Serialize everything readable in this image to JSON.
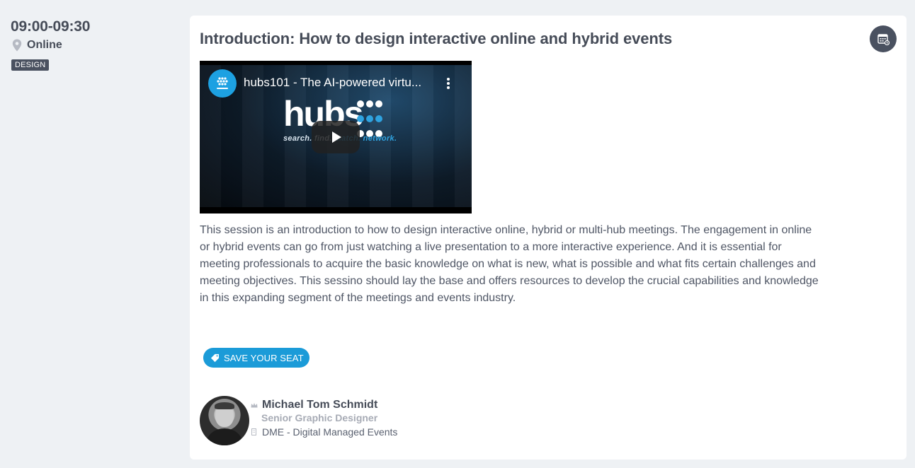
{
  "session": {
    "time": "09:00-09:30",
    "location": "Online",
    "tag": "DESIGN",
    "title": "Introduction: How to design interactive online and hybrid events",
    "description": "This session is an introduction to how to design interactive online, hybrid or multi-hub meetings. The engagement in online or hybrid events can go from just watching a live presentation to a more interactive experience. And it is essential for meeting professionals to acquire the basic knowledge on what is new, what is possible and what fits certain challenges and meeting objectives. This sessino should lay the base and offers resources to develop the crucial capabilities and knowledge in this expanding segment of the meetings and events industry.",
    "save_seat_label": "SAVE YOUR SEAT",
    "add_to_calendar_icon": "calendar-icon"
  },
  "video": {
    "title": "hubs101 - The AI-powered virtu...",
    "logo_text": "hubs",
    "tagline_a": "search. find. ",
    "tagline_b": "match. network.",
    "channel_icon": "channel-logo-icon",
    "play_icon": "play-icon",
    "menu_icon": "kebab-menu-icon"
  },
  "speaker": {
    "name": "Michael Tom Schmidt",
    "role": "Senior Graphic Designer",
    "company": "DME - Digital Managed Events",
    "name_icon": "crown-icon",
    "company_icon": "building-icon"
  },
  "colors": {
    "page_bg": "#eef1f4",
    "card_bg": "#ffffff",
    "accent": "#1b9bd8",
    "dark": "#4a5160",
    "muted": "#a7abb5"
  }
}
